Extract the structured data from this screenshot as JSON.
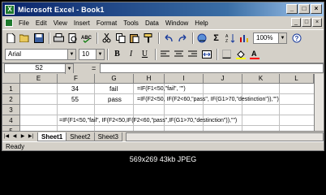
{
  "window": {
    "title": "Microsoft Excel - Book1",
    "app_icon": "X",
    "min": "_",
    "max": "□",
    "close": "×"
  },
  "menu": [
    "File",
    "Edit",
    "View",
    "Insert",
    "Format",
    "Tools",
    "Data",
    "Window",
    "Help"
  ],
  "toolbar": {
    "zoom": "100%"
  },
  "format": {
    "font": "Arial",
    "size": "10"
  },
  "formula_bar": {
    "name_box": "S2",
    "equals": "="
  },
  "columns": [
    "E",
    "F",
    "G",
    "H",
    "I",
    "J",
    "K",
    "L"
  ],
  "rows": [
    "1",
    "2",
    "3",
    "4",
    "5"
  ],
  "cells": {
    "f1": "34",
    "g1": "fail",
    "h1": "=IF(F1<50,\"fail\", \"\")",
    "f2": "55",
    "g2": "pass",
    "h2": "=IF(F2<50, IF(F2<60,\"pass\", IF(G1>70,\"destinction\")),\"\")",
    "e4": "=IF(F1<50,\"fail\",  IF(F2<50,IF(F2<60,\"pass\",IF(G1>70,\"destinction\")),\"\")"
  },
  "sheets": [
    "Sheet1",
    "Sheet2",
    "Sheet3"
  ],
  "status": "Ready",
  "caption": "569x269 43kb JPEG"
}
